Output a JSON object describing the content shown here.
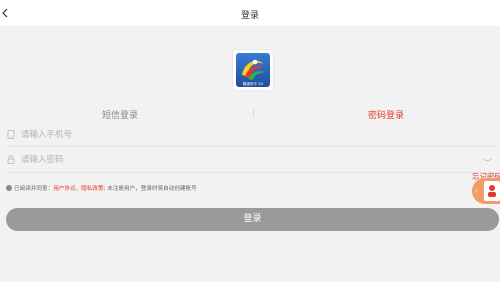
{
  "header": {
    "title": "登录"
  },
  "tabs": [
    {
      "label": "短信登录",
      "active": false
    },
    {
      "label": "密码登录",
      "active": true
    }
  ],
  "phone_field": {
    "placeholder": "请输入手机号",
    "value": ""
  },
  "password_field": {
    "placeholder": "请输入密码",
    "value": ""
  },
  "agreement": {
    "prefix": "已阅读并同意",
    "user_agreement": "用户协议",
    "separator": "、",
    "privacy_policy": "隐私政策",
    "suffix": "; 未注册用户，登录时将自动创建账号"
  },
  "forgot_password": "忘记密码",
  "login_button": "登录",
  "logo_text": "融媒贵平 SU",
  "colors": {
    "accent": "#e33a2b",
    "button_disabled": "#9a9a9a",
    "background": "#f2f2f2",
    "float_badge": "#f29b6b"
  },
  "icons": {
    "back": "chevron-left-icon",
    "phone": "phone-icon",
    "lock": "lock-icon",
    "eye": "eye-closed-icon",
    "check": "check-circle-icon"
  }
}
